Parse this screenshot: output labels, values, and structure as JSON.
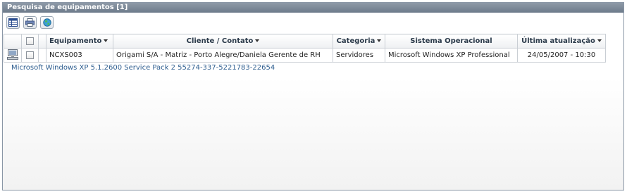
{
  "panel": {
    "title": "Pesquisa de equipamentos [1]"
  },
  "toolbar": {
    "buttons": [
      {
        "icon": "table-view-icon"
      },
      {
        "icon": "printer-icon"
      },
      {
        "icon": "globe-icon"
      }
    ]
  },
  "table": {
    "columns": [
      "Equipamento",
      "Cliente / Contato",
      "Categoria",
      "Sistema Operacional",
      "Última atualização"
    ],
    "rows": [
      {
        "icon": "computer-icon",
        "cells": [
          "NCXS003",
          "Origami S/A - Matriz - Porto Alegre/Daniela Gerente de RH",
          "Servidores",
          "Microsoft Windows XP Professional",
          "24/05/2007 - 10:30"
        ],
        "detail": "Microsoft Windows XP 5.1.2600 Service Pack 2 55274-337-5221783-22654"
      }
    ]
  }
}
